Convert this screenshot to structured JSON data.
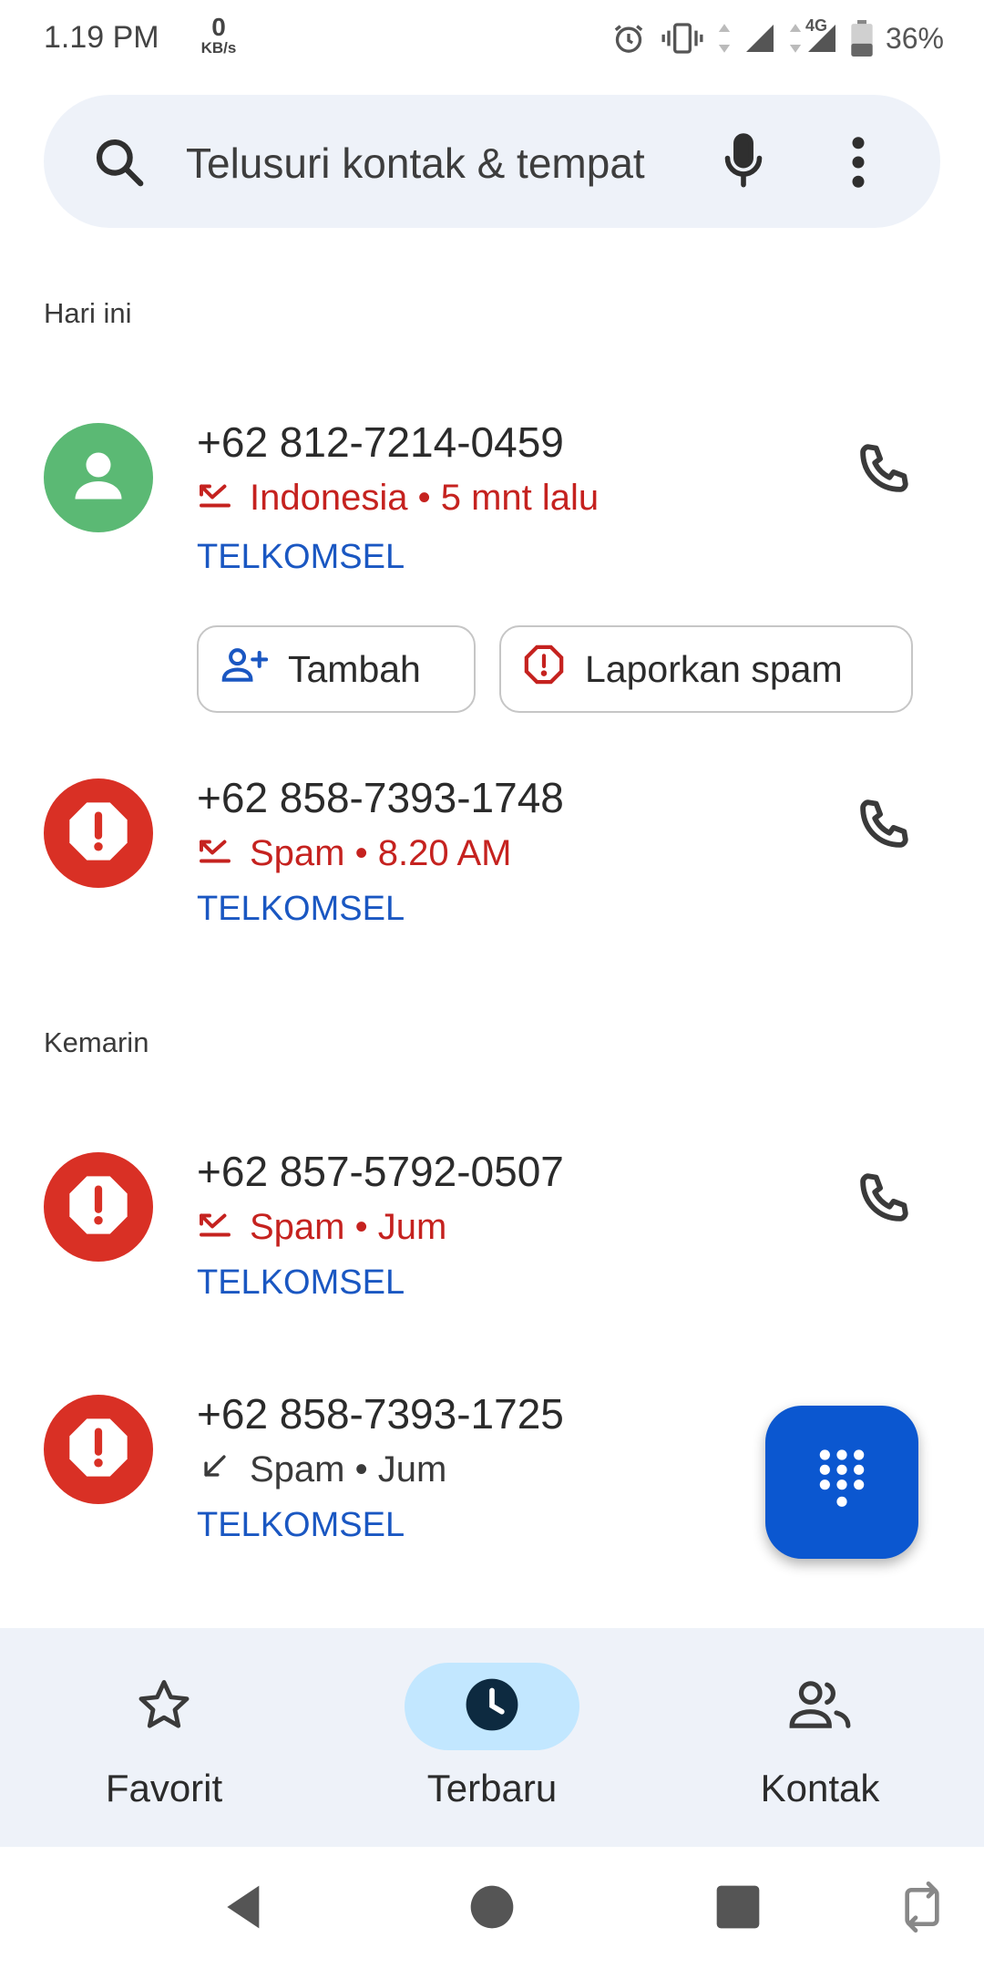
{
  "status_bar": {
    "time": "1.19 PM",
    "net_speed_value": "0",
    "net_speed_unit": "KB/s",
    "network_type": "4G",
    "battery": "36%",
    "icons": [
      "alarm-icon",
      "vibrate-icon",
      "signal-icon",
      "battery-icon"
    ]
  },
  "search": {
    "placeholder": "Telusuri kontak & tempat",
    "icons": [
      "search-icon",
      "mic-icon",
      "more-vert-icon"
    ]
  },
  "sections": [
    {
      "header": "Hari ini",
      "calls": [
        {
          "number": "+62 812-7214-0459",
          "meta": "Indonesia • 5 mnt lalu",
          "carrier": "TELKOMSEL",
          "avatar": "person-icon",
          "call_type": "missed",
          "actions": [
            {
              "label": "Tambah",
              "icon": "add-contact-icon"
            },
            {
              "label": "Laporkan spam",
              "icon": "report-spam-icon"
            }
          ]
        },
        {
          "number": "+62 858-7393-1748",
          "meta": "Spam • 8.20 AM",
          "carrier": "TELKOMSEL",
          "avatar": "spam-icon",
          "call_type": "missed"
        }
      ]
    },
    {
      "header": "Kemarin",
      "calls": [
        {
          "number": "+62 857-5792-0507",
          "meta": "Spam • Jum",
          "carrier": "TELKOMSEL",
          "avatar": "spam-icon",
          "call_type": "missed"
        },
        {
          "number": "+62 858-7393-1725",
          "meta": "Spam • Jum",
          "carrier": "TELKOMSEL",
          "avatar": "spam-icon",
          "call_type": "incoming"
        }
      ]
    }
  ],
  "bottom_nav": {
    "items": [
      {
        "label": "Favorit",
        "icon": "star-icon",
        "active": false
      },
      {
        "label": "Terbaru",
        "icon": "clock-icon",
        "active": true
      },
      {
        "label": "Kontak",
        "icon": "contacts-icon",
        "active": false
      }
    ]
  },
  "system_nav": [
    "back-icon",
    "home-icon",
    "recents-icon",
    "rotate-icon"
  ],
  "colors": {
    "accent": "#0b57d0",
    "missed": "#c5221f",
    "spam_avatar": "#d93025",
    "person_avatar": "#5bb974",
    "carrier": "#1a57c2",
    "nav_background": "#eef2f9",
    "nav_active_pill": "#c2e7ff"
  }
}
